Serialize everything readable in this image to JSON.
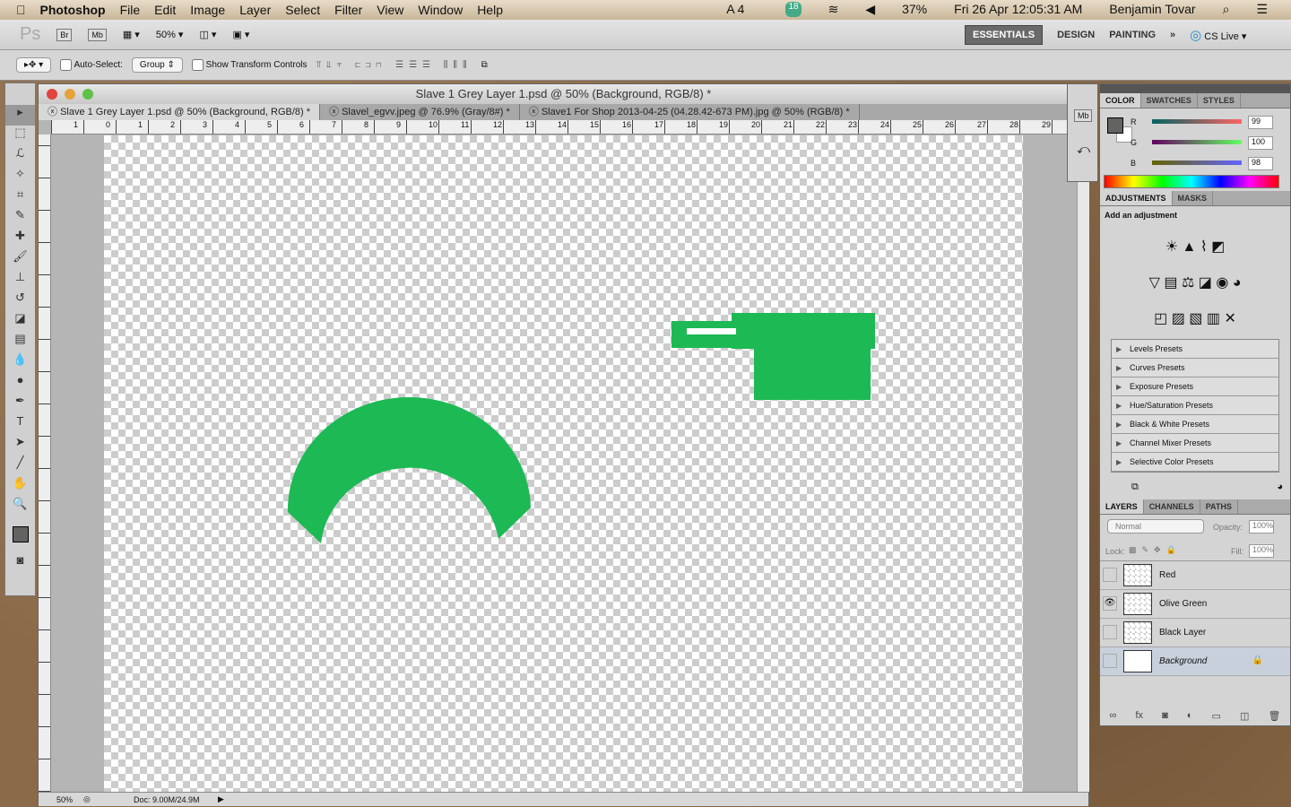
{
  "menubar": {
    "app": "Photoshop",
    "items": [
      "File",
      "Edit",
      "Image",
      "Layer",
      "Select",
      "Filter",
      "View",
      "Window",
      "Help"
    ],
    "status": {
      "adobe_count": "4",
      "badge": "18",
      "battery": "37%",
      "datetime": "Fri 26 Apr  12:05:31 AM",
      "user": "Benjamin Tovar"
    }
  },
  "appbar": {
    "logo": "Ps",
    "bridge": "Br",
    "minibridge": "Mb",
    "zoom": "50%",
    "workspaces": [
      "ESSENTIALS",
      "DESIGN",
      "PAINTING"
    ],
    "more": "»",
    "cslive": "CS Live"
  },
  "options": {
    "auto_select_label": "Auto-Select:",
    "auto_select_value": "Group",
    "transform_label": "Show Transform Controls"
  },
  "document": {
    "title": "Slave 1 Grey Layer 1.psd @ 50% (Background, RGB/8) *",
    "tabs": [
      "Slave 1 Grey Layer 1.psd @ 50% (Background, RGB/8) *",
      "Slavel_egvv.jpeg @ 76.9% (Gray/8#) *",
      "Slave1 For Shop 2013-04-25 (04.28.42-673 PM).jpg @ 50% (RGB/8) *"
    ],
    "ruler_marks": [
      "1",
      "0",
      "1",
      "2",
      "3",
      "4",
      "5",
      "6",
      "7",
      "8",
      "9",
      "10",
      "11",
      "12",
      "13",
      "14",
      "15",
      "16",
      "17",
      "18",
      "19",
      "20",
      "21",
      "22",
      "23",
      "24",
      "25",
      "26",
      "27",
      "28",
      "29"
    ],
    "zoom": "50%",
    "doc_size": "Doc: 9.00M/24.9M",
    "shape_color": "#1db954"
  },
  "color_panel": {
    "tabs": [
      "COLOR",
      "SWATCHES",
      "STYLES"
    ],
    "r": "99",
    "g": "100",
    "b": "98",
    "foreground": "#636462",
    "background": "#ffffff"
  },
  "adjustments": {
    "tabs": [
      "ADJUSTMENTS",
      "MASKS"
    ],
    "heading": "Add an adjustment",
    "presets": [
      "Levels Presets",
      "Curves Presets",
      "Exposure Presets",
      "Hue/Saturation Presets",
      "Black & White Presets",
      "Channel Mixer Presets",
      "Selective Color Presets"
    ]
  },
  "layers": {
    "tabs": [
      "LAYERS",
      "CHANNELS",
      "PATHS"
    ],
    "blend": "Normal",
    "opacity_label": "Opacity:",
    "opacity": "100%",
    "lock_label": "Lock:",
    "fill_label": "Fill:",
    "fill": "100%",
    "items": [
      {
        "name": "Red",
        "visible": false
      },
      {
        "name": "Olive Green",
        "visible": true
      },
      {
        "name": "Black Layer",
        "visible": false
      },
      {
        "name": "Background",
        "visible": false,
        "locked": true
      }
    ]
  }
}
